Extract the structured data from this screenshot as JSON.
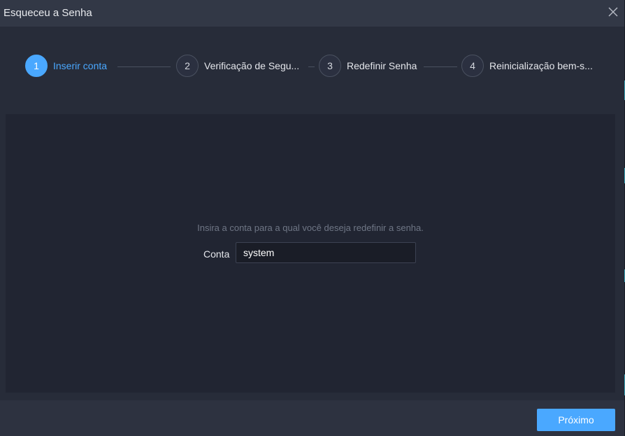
{
  "dialog": {
    "title": "Esqueceu a Senha",
    "close_icon": "close-icon"
  },
  "steps": [
    {
      "number": "1",
      "label": "Inserir conta",
      "state": "active"
    },
    {
      "number": "2",
      "label": "Verificação de Segu...",
      "state": "pending"
    },
    {
      "number": "3",
      "label": "Redefinir Senha",
      "state": "pending"
    },
    {
      "number": "4",
      "label": "Reinicialização bem-s...",
      "state": "pending"
    }
  ],
  "form": {
    "hint": "Insira a conta para a qual você deseja redefinir a senha.",
    "account_label": "Conta",
    "account_value": "system"
  },
  "footer": {
    "next_label": "Próximo"
  },
  "colors": {
    "accent": "#4aa8ff",
    "background": "#272c39",
    "content_panel": "#212532",
    "titlebar": "#323846"
  }
}
